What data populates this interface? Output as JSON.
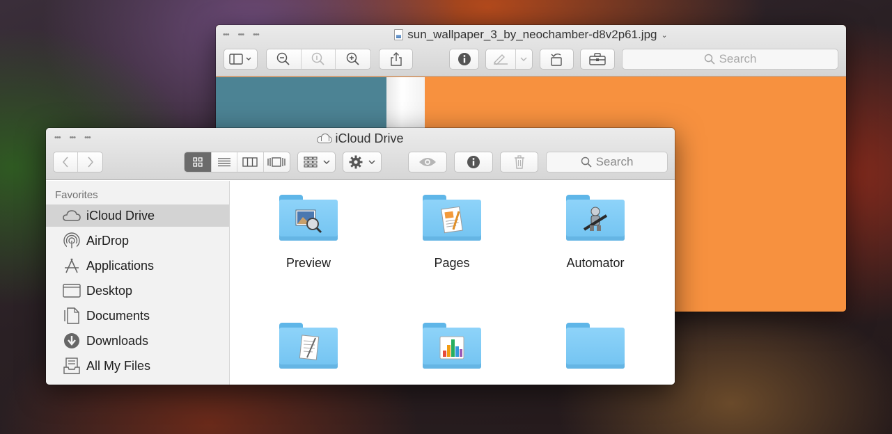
{
  "preview_window": {
    "title": "sun_wallpaper_3_by_neochamber-d8v2p61.jpg",
    "search_placeholder": "Search",
    "toolbar_icons": [
      "sidebar-icon",
      "zoom-out-icon",
      "actual-size-icon",
      "zoom-in-icon",
      "share-icon",
      "info-icon",
      "markup-icon",
      "rotate-icon",
      "toolbox-icon"
    ]
  },
  "finder_window": {
    "title": "iCloud Drive",
    "search_placeholder": "Search",
    "sidebar": {
      "section_header": "Favorites",
      "items": [
        {
          "label": "iCloud Drive",
          "icon": "cloud-icon"
        },
        {
          "label": "AirDrop",
          "icon": "airdrop-icon"
        },
        {
          "label": "Applications",
          "icon": "applications-icon"
        },
        {
          "label": "Desktop",
          "icon": "desktop-icon"
        },
        {
          "label": "Documents",
          "icon": "documents-icon"
        },
        {
          "label": "Downloads",
          "icon": "downloads-icon"
        },
        {
          "label": "All My Files",
          "icon": "all-files-icon"
        }
      ]
    },
    "folders": [
      {
        "label": "Preview",
        "icon": "preview-folder-icon"
      },
      {
        "label": "Pages",
        "icon": "pages-folder-icon"
      },
      {
        "label": "Automator",
        "icon": "automator-folder-icon"
      },
      {
        "label": "",
        "icon": "textedit-folder-icon"
      },
      {
        "label": "",
        "icon": "numbers-folder-icon"
      },
      {
        "label": "",
        "icon": "plain-folder-icon"
      }
    ]
  },
  "colors": {
    "preview_orange": "#f7913f",
    "preview_teal": "#4c8394",
    "folder_blue": "#7ecbf5",
    "sidebar_selected": "#d3d3d3"
  }
}
